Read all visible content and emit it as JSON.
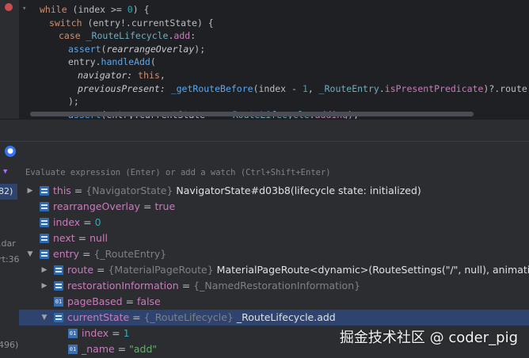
{
  "editor": {
    "lines": [
      {
        "indent": 2,
        "tokens": [
          [
            "kw",
            "while "
          ],
          [
            "pu",
            "(index >= "
          ],
          [
            "num",
            "0"
          ],
          [
            "pu",
            ") {"
          ]
        ]
      },
      {
        "indent": 4,
        "tokens": [
          [
            "kw",
            "switch "
          ],
          [
            "pu",
            "(entry!.currentState) {"
          ]
        ]
      },
      {
        "indent": 6,
        "tokens": [
          [
            "kw",
            "case "
          ],
          [
            "ty",
            "_RouteLifecycle"
          ],
          [
            "pu",
            "."
          ],
          [
            "cn",
            "add"
          ],
          [
            "pu",
            ":"
          ]
        ]
      },
      {
        "indent": 8,
        "tokens": [
          [
            "fn",
            "assert"
          ],
          [
            "pu",
            "("
          ],
          [
            "it",
            "rearrangeOverlay"
          ],
          [
            "pu",
            ");"
          ]
        ]
      },
      {
        "indent": 8,
        "tokens": [
          [
            "pu",
            "entry."
          ],
          [
            "fn",
            "handleAdd"
          ],
          [
            "pu",
            "("
          ]
        ]
      },
      {
        "indent": 10,
        "tokens": [
          [
            "it",
            "navigator: "
          ],
          [
            "kw",
            "this"
          ],
          [
            "pu",
            ","
          ]
        ]
      },
      {
        "indent": 10,
        "tokens": [
          [
            "it",
            "previousPresent: "
          ],
          [
            "fn",
            "_getRouteBefore"
          ],
          [
            "pu",
            "(index - "
          ],
          [
            "num",
            "1"
          ],
          [
            "pu",
            ", "
          ],
          [
            "ty",
            "_RouteEntry"
          ],
          [
            "pu",
            "."
          ],
          [
            "cn",
            "isPresentPredicate"
          ],
          [
            "pu",
            ")?.route,"
          ]
        ]
      },
      {
        "indent": 8,
        "tokens": [
          [
            "pu",
            ");"
          ]
        ]
      },
      {
        "indent": 8,
        "tokens": [
          [
            "fn",
            "assert"
          ],
          [
            "pu",
            "(entry.currentState == "
          ],
          [
            "ty",
            "_RouteLifecycle"
          ],
          [
            "pu",
            "."
          ],
          [
            "cn",
            "adding"
          ],
          [
            "pu",
            ");"
          ]
        ]
      }
    ]
  },
  "evaluate": {
    "placeholder": "Evaluate expression (Enter) or add a watch (Ctrl+Shift+Enter)"
  },
  "frames": [
    "82)",
    ".dar",
    "rt:36",
    "496)"
  ],
  "variables": [
    {
      "depth": 0,
      "arrow": "collapsed",
      "icon": "field",
      "name": "this",
      "type": "{NavigatorState}",
      "value": "NavigatorState#d03b8(lifecycle state: initialized)",
      "kind": "obj"
    },
    {
      "depth": 0,
      "arrow": "none",
      "icon": "field",
      "name": "rearrangeOverlay",
      "type": "",
      "value": "true",
      "kind": "bool"
    },
    {
      "depth": 0,
      "arrow": "none",
      "icon": "field",
      "name": "index",
      "type": "",
      "value": "0",
      "kind": "num"
    },
    {
      "depth": 0,
      "arrow": "none",
      "icon": "field",
      "name": "next",
      "type": "",
      "value": "null",
      "kind": "bool"
    },
    {
      "depth": 0,
      "arrow": "expanded",
      "icon": "field",
      "name": "entry",
      "type": "{_RouteEntry}",
      "value": "",
      "kind": "obj"
    },
    {
      "depth": 1,
      "arrow": "collapsed",
      "icon": "field",
      "name": "route",
      "type": "{MaterialPageRoute}",
      "value": "MaterialPageRoute<dynamic>(RouteSettings(\"/\", null), animation: null)",
      "kind": "obj"
    },
    {
      "depth": 1,
      "arrow": "collapsed",
      "icon": "field",
      "name": "restorationInformation",
      "type": "{_NamedRestorationInformation}",
      "value": "",
      "kind": "obj"
    },
    {
      "depth": 1,
      "arrow": "none",
      "icon": "prim",
      "name": "pageBased",
      "type": "",
      "value": "false",
      "kind": "bool"
    },
    {
      "depth": 1,
      "arrow": "expanded",
      "icon": "field",
      "name": "currentState",
      "type": "{_RouteLifecycle}",
      "value": "_RouteLifecycle.add",
      "kind": "obj",
      "selected": true
    },
    {
      "depth": 2,
      "arrow": "none",
      "icon": "prim",
      "name": "index",
      "type": "",
      "value": "1",
      "kind": "num"
    },
    {
      "depth": 2,
      "arrow": "none",
      "icon": "prim",
      "name": "_name",
      "type": "",
      "value": "\"add\"",
      "kind": "str"
    }
  ],
  "watermark": "掘金技术社区 @ coder_pig"
}
